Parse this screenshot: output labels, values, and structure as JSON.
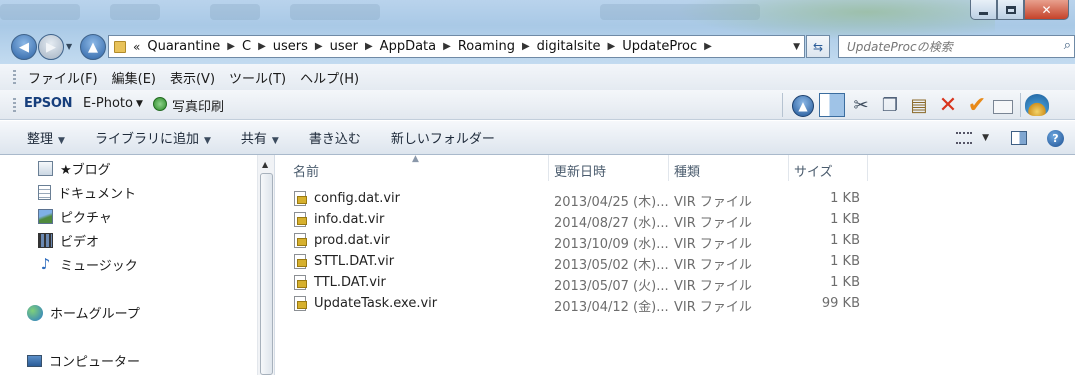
{
  "window": {
    "address_path": [
      "Quarantine",
      "C",
      "users",
      "user",
      "AppData",
      "Roaming",
      "digitalsite",
      "UpdateProc"
    ],
    "address_overflow": "«",
    "search_placeholder": "UpdateProcの検索"
  },
  "menu": [
    "ファイル(F)",
    "編集(E)",
    "表示(V)",
    "ツール(T)",
    "ヘルプ(H)"
  ],
  "epson_toolbar": {
    "brand": "EPSON",
    "app": "E-Photo",
    "print_label": "写真印刷"
  },
  "commands": {
    "organize": "整理",
    "add_library": "ライブラリに追加",
    "share": "共有",
    "burn": "書き込む",
    "new_folder": "新しいフォルダー"
  },
  "nav": {
    "items": [
      {
        "label": "★ブログ",
        "icon": "blog-icon"
      },
      {
        "label": "ドキュメント",
        "icon": "document-icon"
      },
      {
        "label": "ピクチャ",
        "icon": "pictures-icon"
      },
      {
        "label": "ビデオ",
        "icon": "video-icon"
      },
      {
        "label": "ミュージック",
        "icon": "music-icon"
      }
    ],
    "homegroup": "ホームグループ",
    "computer": "コンピューター"
  },
  "columns": {
    "name": "名前",
    "modified": "更新日時",
    "type": "種類",
    "size": "サイズ"
  },
  "files": [
    {
      "name": "config.dat.vir",
      "modified": "2013/04/25 (木)...",
      "type": "VIR ファイル",
      "size": "1 KB"
    },
    {
      "name": "info.dat.vir",
      "modified": "2014/08/27 (水)...",
      "type": "VIR ファイル",
      "size": "1 KB"
    },
    {
      "name": "prod.dat.vir",
      "modified": "2013/10/09 (水)...",
      "type": "VIR ファイル",
      "size": "1 KB"
    },
    {
      "name": "STTL.DAT.vir",
      "modified": "2013/05/02 (木)...",
      "type": "VIR ファイル",
      "size": "1 KB"
    },
    {
      "name": "TTL.DAT.vir",
      "modified": "2013/05/07 (火)...",
      "type": "VIR ファイル",
      "size": "1 KB"
    },
    {
      "name": "UpdateTask.exe.vir",
      "modified": "2013/04/12 (金)...",
      "type": "VIR ファイル",
      "size": "99 KB"
    }
  ]
}
